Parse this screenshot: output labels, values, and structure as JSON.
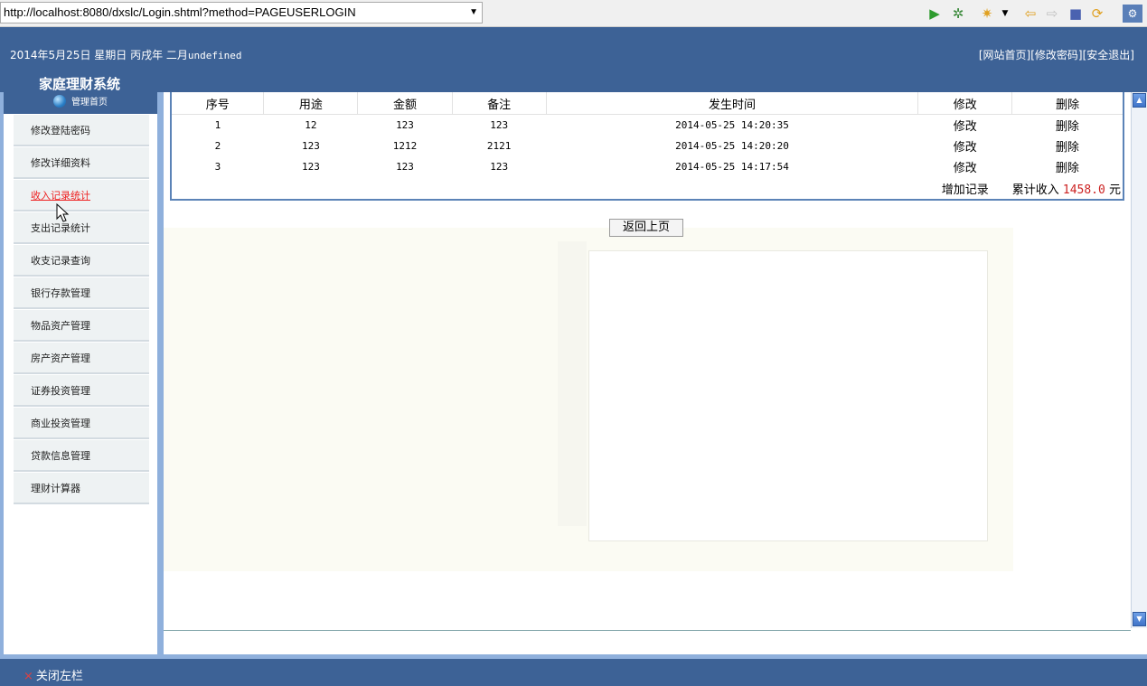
{
  "browser": {
    "url": "http://localhost:8080/dxslc/Login.shtml?method=PAGEUSERLOGIN"
  },
  "header": {
    "date_text": "2014年5月25日 星期日 丙戌年 二月",
    "date_tail": "undefined",
    "links": [
      "[网站首页]",
      "[修改密码]",
      "[安全退出]"
    ],
    "system_title": "家庭理财系统"
  },
  "sidebar": {
    "home_label": "管理首页",
    "items": [
      {
        "label": "修改登陆密码"
      },
      {
        "label": "修改详细资料"
      },
      {
        "label": "收入记录统计"
      },
      {
        "label": "支出记录统计"
      },
      {
        "label": "收支记录查询"
      },
      {
        "label": "银行存款管理"
      },
      {
        "label": "物品资产管理"
      },
      {
        "label": "房产资产管理"
      },
      {
        "label": "证券投资管理"
      },
      {
        "label": "商业投资管理"
      },
      {
        "label": "贷款信息管理"
      },
      {
        "label": "理财计算器"
      }
    ],
    "active_index": 2
  },
  "table": {
    "headers": [
      "序号",
      "用途",
      "金额",
      "备注",
      "发生时间",
      "修改",
      "删除"
    ],
    "rows": [
      {
        "no": "1",
        "purpose": "12",
        "amount": "123",
        "note": "123",
        "time": "2014-05-25 14:20:35",
        "edit": "修改",
        "delete": "删除"
      },
      {
        "no": "2",
        "purpose": "123",
        "amount": "1212",
        "note": "2121",
        "time": "2014-05-25 14:20:20",
        "edit": "修改",
        "delete": "删除"
      },
      {
        "no": "3",
        "purpose": "123",
        "amount": "123",
        "note": "123",
        "time": "2014-05-25 14:17:54",
        "edit": "修改",
        "delete": "删除"
      }
    ],
    "add_record": "增加记录",
    "total_label": "累计收入",
    "total_value": "1458.0",
    "total_unit": "元"
  },
  "back_button": "返回上页",
  "footer": {
    "close_left": "关闭左栏"
  },
  "colors": {
    "header_bg": "#3d6296",
    "frame_blue": "#8fb0dc",
    "active_link": "#e22222",
    "total_red": "#cc2222"
  }
}
